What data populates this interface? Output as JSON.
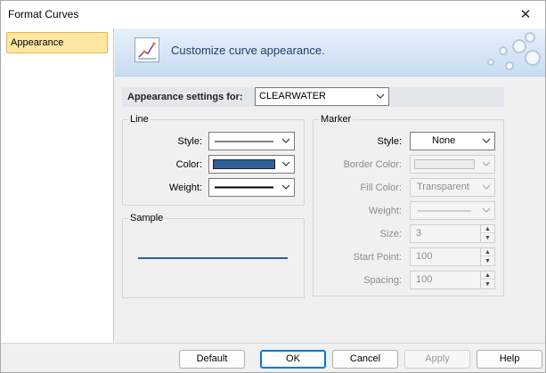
{
  "window": {
    "title": "Format Curves"
  },
  "sidebar": {
    "items": [
      {
        "label": "Appearance"
      }
    ]
  },
  "banner": {
    "text": "Customize curve appearance."
  },
  "appearance": {
    "label": "Appearance settings for:",
    "value": "CLEARWATER"
  },
  "line": {
    "title": "Line",
    "style_label": "Style:",
    "color_label": "Color:",
    "weight_label": "Weight:",
    "color_value": "#2f5f96"
  },
  "sample": {
    "title": "Sample"
  },
  "marker": {
    "title": "Marker",
    "style_label": "Style:",
    "style_value": "None",
    "border_color_label": "Border Color:",
    "fill_color_label": "Fill Color:",
    "fill_color_value": "Transparent",
    "weight_label": "Weight:",
    "size_label": "Size:",
    "size_value": "3",
    "start_point_label": "Start Point:",
    "start_point_value": "100",
    "spacing_label": "Spacing:",
    "spacing_value": "100"
  },
  "footer": {
    "default_label": "Default",
    "ok_label": "OK",
    "cancel_label": "Cancel",
    "apply_label": "Apply",
    "help_label": "Help"
  }
}
